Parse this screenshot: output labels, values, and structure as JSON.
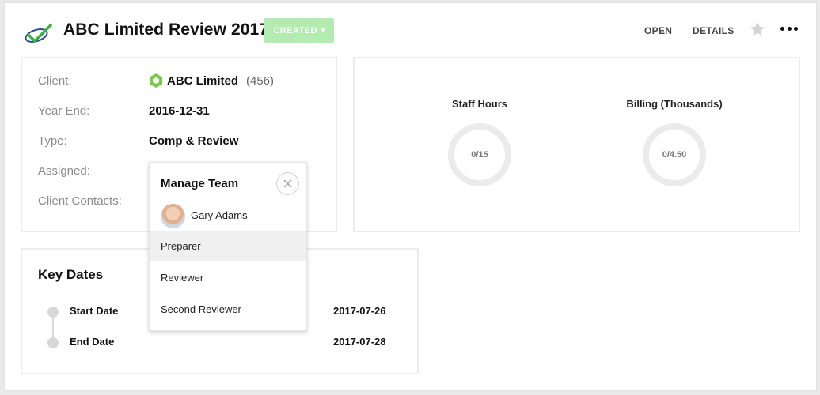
{
  "header": {
    "title": "ABC Limited Review 2017",
    "status_label": "CREATED",
    "open_label": "OPEN",
    "details_label": "DETAILS",
    "status_color": "#b3ecb0"
  },
  "info": {
    "client_label": "Client:",
    "client_name": "ABC Limited",
    "client_count": "(456)",
    "year_end_label": "Year End:",
    "year_end_value": "2016-12-31",
    "type_label": "Type:",
    "type_value": "Comp & Review",
    "assigned_label": "Assigned:",
    "contacts_label": "Client Contacts:"
  },
  "stats": [
    {
      "label": "Staff Hours",
      "value": "0/15"
    },
    {
      "label": "Billing (Thousands)",
      "value": "0/4.50"
    }
  ],
  "key_dates": {
    "title": "Key Dates",
    "items": [
      {
        "label": "Start Date",
        "value": "2017-07-26"
      },
      {
        "label": "End Date",
        "value": "2017-07-28"
      }
    ]
  },
  "manage_team": {
    "title": "Manage Team",
    "member_name": "Gary Adams",
    "roles": [
      "Preparer",
      "Reviewer",
      "Second Reviewer"
    ],
    "active_role": "Preparer"
  },
  "icons": {
    "logo": "checkmark-swoosh-logo",
    "client": "hexagon-icon",
    "star": "star-icon",
    "more": "more-dots-icon",
    "close": "close-icon"
  }
}
